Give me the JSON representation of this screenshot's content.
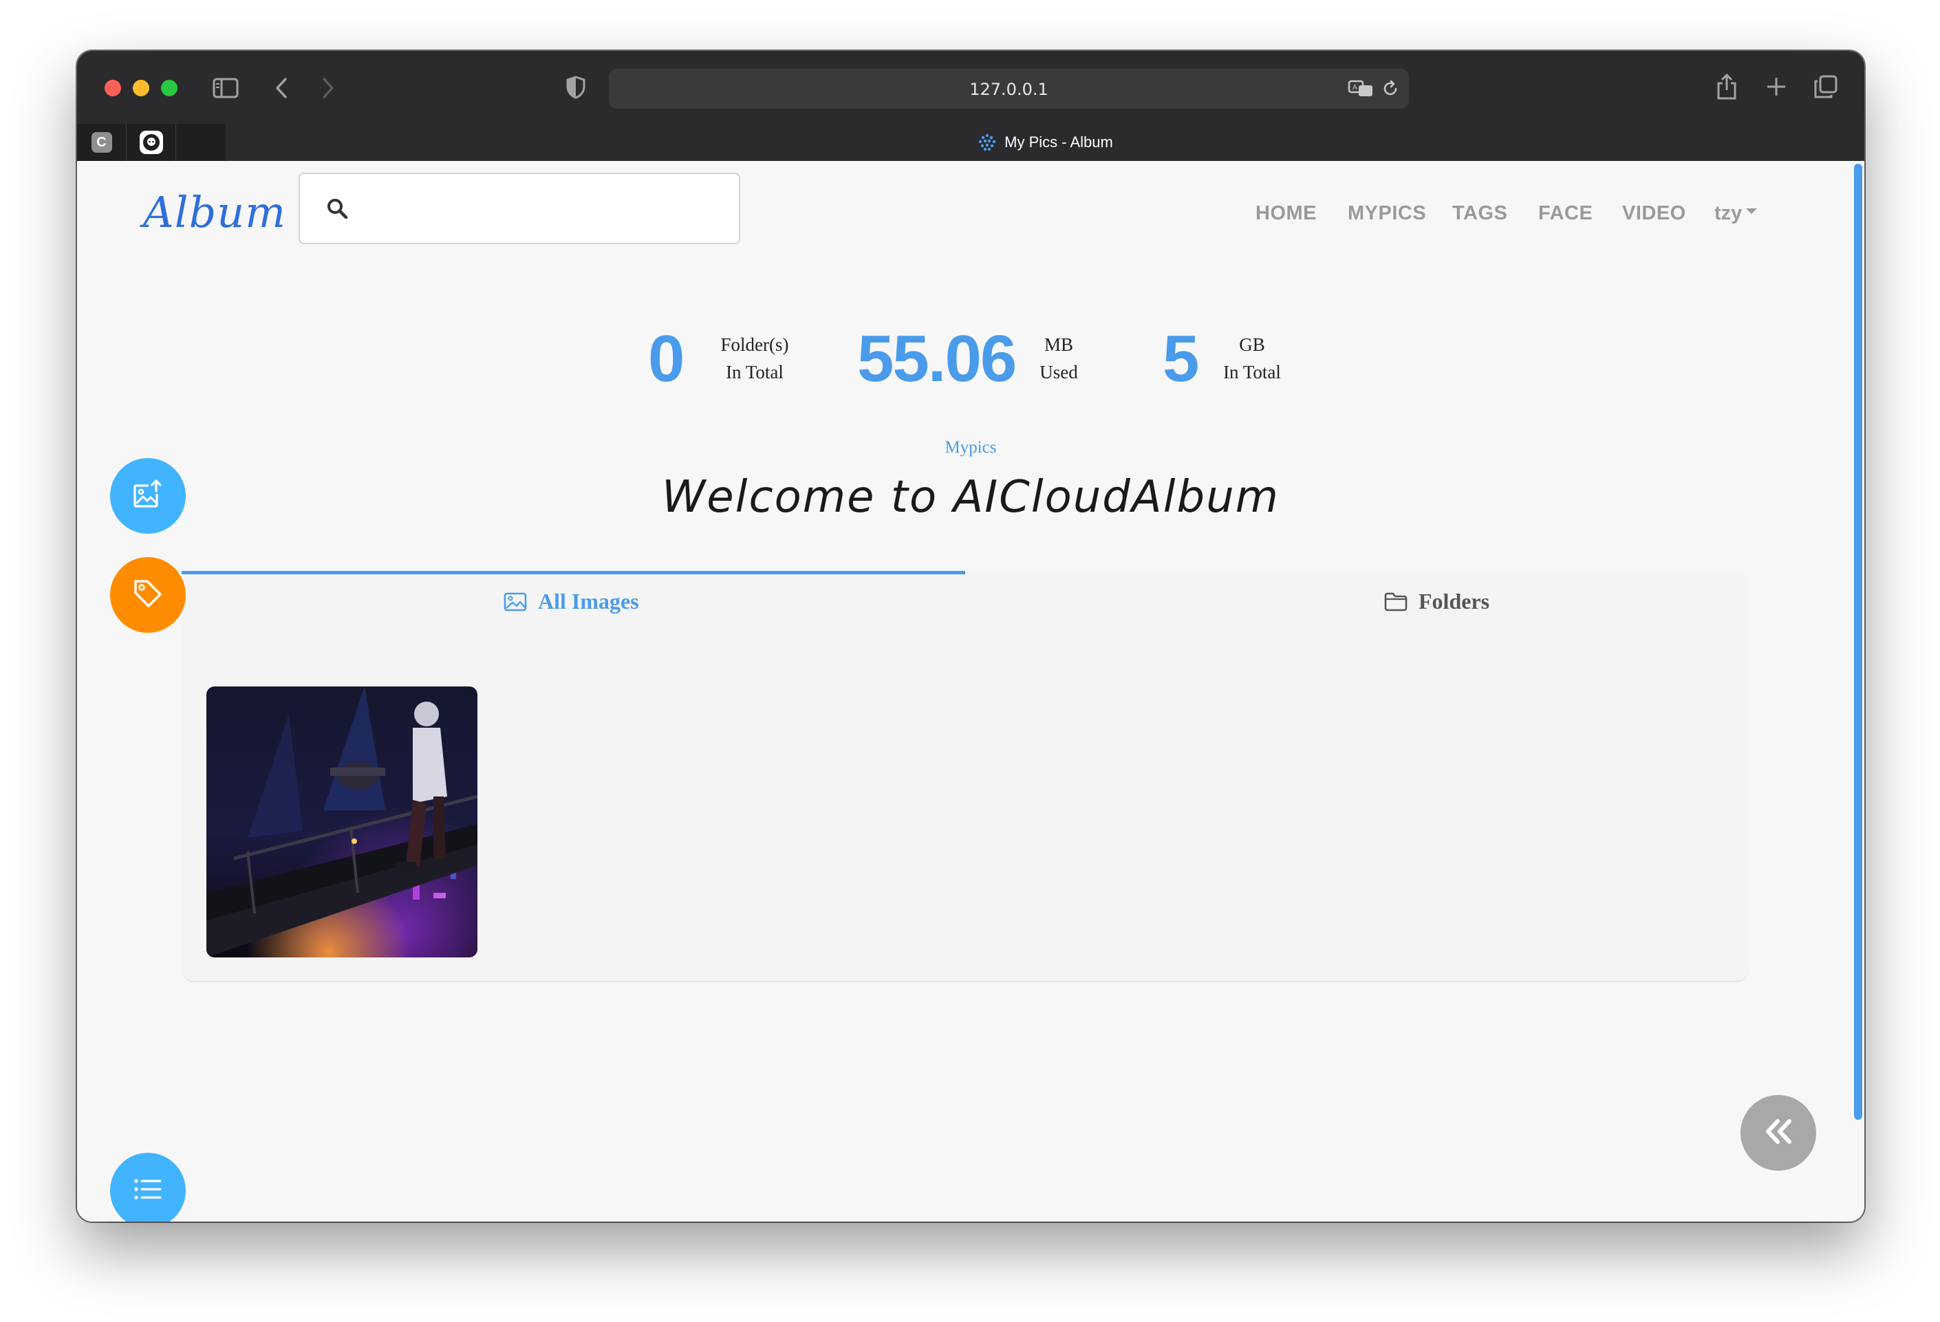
{
  "browser": {
    "url": "127.0.0.1",
    "tab_title": "My Pics - Album",
    "pinned_tab_1_letter": "C"
  },
  "header": {
    "logo": "Album",
    "search_placeholder": "",
    "nav": {
      "home": "HOME",
      "mypics": "MYPICS",
      "tags": "TAGS",
      "face": "FACE",
      "video": "VIDEO",
      "user": "tzy"
    }
  },
  "stats": {
    "folders": {
      "value": "0",
      "label_line1": "Folder(s)",
      "label_line2": "In Total"
    },
    "used": {
      "value": "55.06",
      "label_line1": "MB",
      "label_line2": "Used"
    },
    "total": {
      "value": "5",
      "label_line1": "GB",
      "label_line2": "In Total"
    }
  },
  "main": {
    "breadcrumb": "Mypics",
    "welcome": "Welcome to AICloudAlbum",
    "tabs": [
      {
        "label": "All Images",
        "active": true
      },
      {
        "label": "Folders",
        "active": false
      }
    ]
  },
  "colors": {
    "accent": "#4a9bea",
    "fab_blue": "#42b3ff",
    "fab_orange": "#ff8c00",
    "fab_gray": "#a8a8a8"
  },
  "icons": {
    "upload": "image-upload-icon",
    "tag": "tag-icon",
    "list": "list-icon",
    "collapse": "double-chevron-left-icon"
  }
}
